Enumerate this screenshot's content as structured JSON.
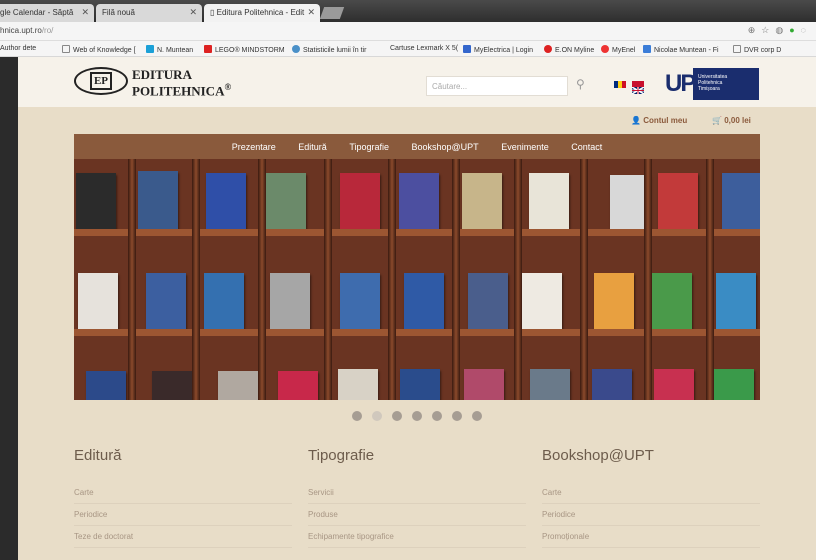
{
  "browser": {
    "tabs": [
      {
        "title": "gle Calendar - Săptă"
      },
      {
        "title": "Filă nouă"
      },
      {
        "title": "Editura Politehnica - Edit"
      }
    ],
    "url_host": "hnica.upt.ro",
    "url_path": "/ro/",
    "bookmarks": [
      "Author dete",
      "Web of Knowledge [",
      "N. Muntean",
      "LEGO® MINDSTORM",
      "Statisticile lumii în tir",
      "Cartuse Lexmark X 5(",
      "MyElectrica | Login",
      "E.ON Myline",
      "MyEnel",
      "Nicolae Muntean - Fi",
      "DVR corp D"
    ]
  },
  "header": {
    "logo_mark": "EP",
    "logo_line1": "EDITURA",
    "logo_line2": "POLITEHNICA",
    "logo_reg": "®",
    "search_placeholder": "Căutare...",
    "upt_letters": "UPT",
    "upt_line1": "Universitatea",
    "upt_line2": "Politehnica",
    "upt_line3": "Timișoara"
  },
  "account": {
    "label": "Contul meu",
    "cart_amount": "0,00 lei"
  },
  "nav": {
    "items": [
      "Prezentare",
      "Editură",
      "Tipografie",
      "Bookshop@UPT",
      "Evenimente",
      "Contact"
    ]
  },
  "slider": {
    "dot_count": 7,
    "active_index": 0
  },
  "footer": {
    "columns": [
      {
        "title": "Editură",
        "items": [
          "Carte",
          "Periodice",
          "Teze de doctorat"
        ]
      },
      {
        "title": "Tipografie",
        "items": [
          "Servicii",
          "Produse",
          "Echipamente tipografice"
        ]
      },
      {
        "title": "Bookshop@UPT",
        "items": [
          "Carte",
          "Periodice",
          "Promoționale"
        ]
      }
    ]
  },
  "colors": {
    "nav_bg": "#8a5a3c",
    "page_bg": "#e8ddc8",
    "accent_brown": "#8b5a3c",
    "upt_blue": "#1a2d6e"
  }
}
